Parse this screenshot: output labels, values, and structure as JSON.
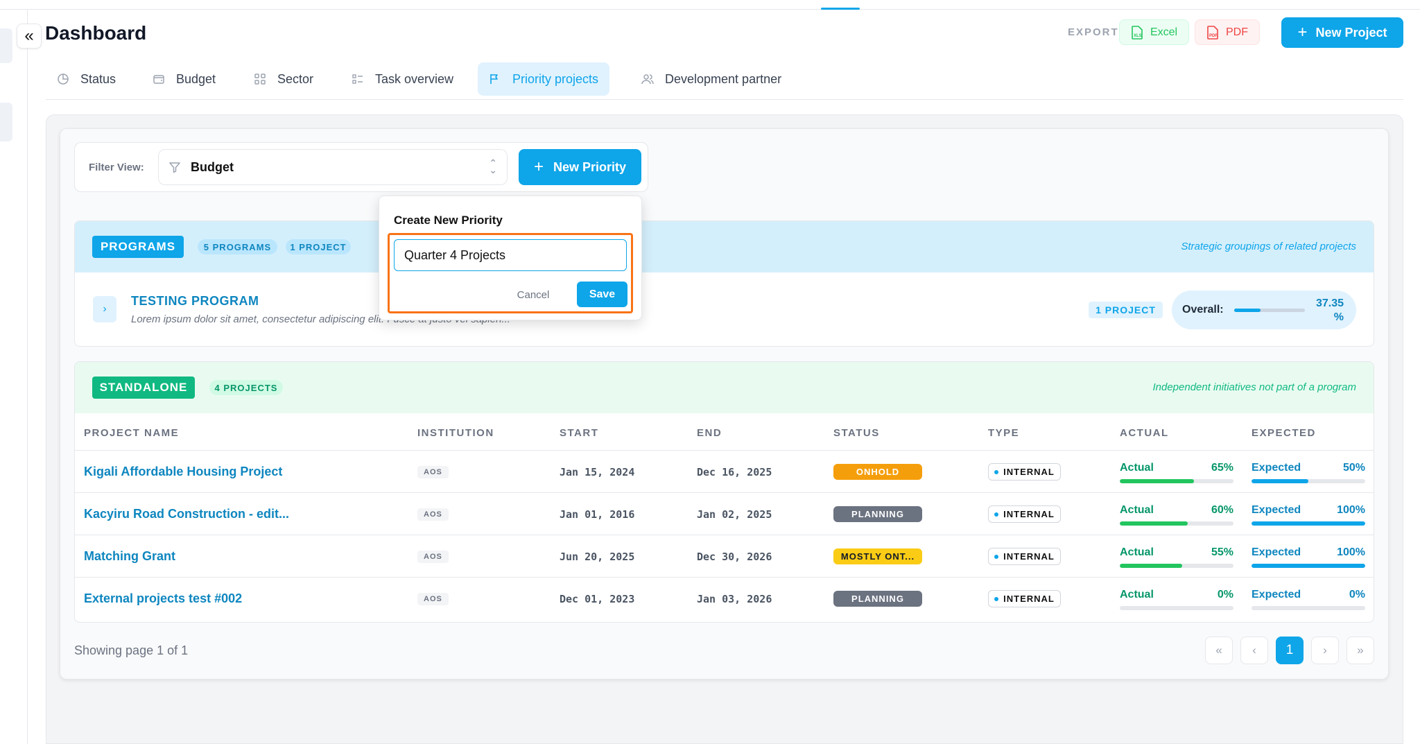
{
  "header": {
    "title": "Dashboard",
    "export_label": "EXPORT",
    "excel_label": "Excel",
    "pdf_label": "PDF",
    "new_project_label": "New Project"
  },
  "tabs": [
    {
      "label": "Status",
      "icon": "pie-chart-icon",
      "active": false
    },
    {
      "label": "Budget",
      "icon": "wallet-icon",
      "active": false
    },
    {
      "label": "Sector",
      "icon": "grid-icon",
      "active": false
    },
    {
      "label": "Task overview",
      "icon": "list-icon",
      "active": false
    },
    {
      "label": "Priority projects",
      "icon": "flag-icon",
      "active": true
    },
    {
      "label": "Development partner",
      "icon": "users-icon",
      "active": false
    }
  ],
  "filter": {
    "label": "Filter View:",
    "selected": "Budget",
    "new_priority_label": "New Priority"
  },
  "popup": {
    "title": "Create New Priority",
    "input_value": "Quarter 4 Projects",
    "cancel_label": "Cancel",
    "save_label": "Save"
  },
  "programs": {
    "badge": "PROGRAMS",
    "count_programs": "5 PROGRAMS",
    "count_projects": "1 PROJECT",
    "note": "Strategic groupings of related projects",
    "items": [
      {
        "name": "TESTING PROGRAM",
        "description": "Lorem ipsum dolor sit amet, consectetur adipiscing elit. Fusce at justo vel sapien...",
        "project_count": "1 PROJECT",
        "overall_label": "Overall:",
        "overall_value": "37.35 %",
        "overall_fraction": 0.3735
      }
    ]
  },
  "standalone": {
    "badge": "STANDALONE",
    "count": "4 PROJECTS",
    "note": "Independent initiatives not part of a program",
    "columns": [
      "PROJECT NAME",
      "INSTITUTION",
      "START",
      "END",
      "STATUS",
      "TYPE",
      "ACTUAL",
      "EXPECTED"
    ],
    "rows": [
      {
        "name": "Kigali Affordable Housing Project",
        "institution": "AOS",
        "start": "Jan 15, 2024",
        "end": "Dec 16, 2025",
        "status": "ONHOLD",
        "type": "INTERNAL",
        "actual_label": "Actual",
        "actual": "65%",
        "actual_fraction": 0.65,
        "expected_label": "Expected",
        "expected": "50%",
        "expected_fraction": 0.5
      },
      {
        "name": "Kacyiru Road Construction - edit...",
        "institution": "AOS",
        "start": "Jan 01, 2016",
        "end": "Jan 02, 2025",
        "status": "PLANNING",
        "type": "INTERNAL",
        "actual_label": "Actual",
        "actual": "60%",
        "actual_fraction": 0.6,
        "expected_label": "Expected",
        "expected": "100%",
        "expected_fraction": 1.0
      },
      {
        "name": "Matching Grant",
        "institution": "AOS",
        "start": "Jun 20, 2025",
        "end": "Dec 30, 2026",
        "status": "MOSTLY ONT...",
        "type": "INTERNAL",
        "actual_label": "Actual",
        "actual": "55%",
        "actual_fraction": 0.55,
        "expected_label": "Expected",
        "expected": "100%",
        "expected_fraction": 1.0
      },
      {
        "name": "External projects test #002",
        "institution": "AOS",
        "start": "Dec 01, 2023",
        "end": "Jan 03, 2026",
        "status": "PLANNING",
        "type": "INTERNAL",
        "actual_label": "Actual",
        "actual": "0%",
        "actual_fraction": 0.0,
        "expected_label": "Expected",
        "expected": "0%",
        "expected_fraction": 0.0
      }
    ]
  },
  "pagination": {
    "summary": "Showing page 1 of 1",
    "current": "1"
  },
  "colors": {
    "accent": "#0ea5e9",
    "onhold": "#f59e0b",
    "planning": "#6b7280",
    "mostly_on_track": "#facc15",
    "actual_bar": "#22c55e",
    "expected_bar": "#0ea5e9",
    "highlight": "#f97316"
  }
}
